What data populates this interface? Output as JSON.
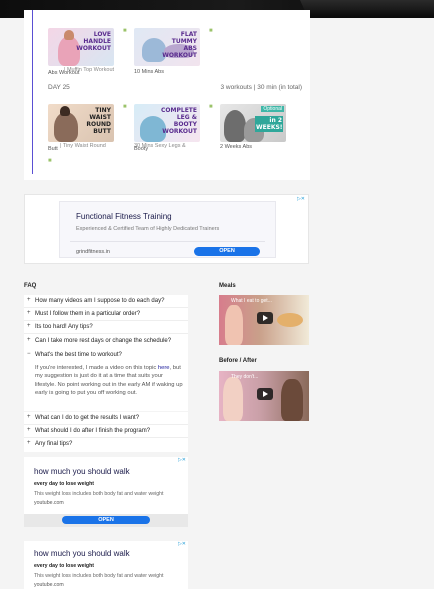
{
  "schedule": {
    "week_row_1": [
      {
        "title": "LOVE HANDLE WORKOUT",
        "caption": "Abs Workout",
        "caption_overlap": "| Muffin Top Workout"
      },
      {
        "title": "FLAT TUMMY ABS WORKOUT",
        "caption": "10 Mins Abs"
      }
    ],
    "day_label": "DAY 25",
    "day_summary": "3 workouts | 30 min (in total)",
    "week_row_2": [
      {
        "title": "TINY WAIST ROUND BUTT",
        "caption": "Butt",
        "caption_overlap": "| Tiny Waist Round"
      },
      {
        "title": "COMPLETE LEG & BOOTY WORKOUT",
        "caption": "Booty",
        "caption_overlap": "30 Mins Sexy Legs &"
      },
      {
        "title": "in 2 WEEKS!",
        "badge": "Optional",
        "caption": "2 Weeks Abs"
      }
    ]
  },
  "ad_top": {
    "title": "Functional Fitness Training",
    "subtitle": "Experienced & Certified Team of Highly Dedicated Trainers",
    "domain": "grindfitness.in",
    "button": "OPEN"
  },
  "faq": {
    "heading": "FAQ",
    "group1": [
      "How many videos am I suppose to do each day?",
      "Must I follow them in a particular order?",
      "Its too hard! Any tips?",
      "Can I take more rest days or change the schedule?",
      "What's the best time to workout?"
    ],
    "answer": {
      "pre": "If you're interested, I made a video on this topic ",
      "link": "here",
      "post": ", but my suggestion is just do it at a time that suits your lifestyle. No point working out in the early AM if waking up early is going to put you off working out."
    },
    "group2": [
      "What can I do to get the results I want?",
      "What should I do after I finish the program?",
      "Any final tips?"
    ]
  },
  "sidebar": {
    "meals_heading": "Meals",
    "meals_video_title": "What I eat to get...",
    "before_after_heading": "Before / After",
    "before_after_video_title": "They don't..."
  },
  "ad_bottom_1": {
    "title": "how much you should walk",
    "line1": "every day to lose weight",
    "line2": "This weight loss includes both body fat and water weight",
    "domain": "youtube.com",
    "button": "OPEN"
  },
  "ad_bottom_2": {
    "title": "how much you should walk",
    "line1": "every day to lose weight",
    "line2": "This weight loss includes both body fat and water weight",
    "domain": "youtube.com"
  },
  "colors": {
    "accent": "#5a4fd3",
    "ad_button": "#1a73e8",
    "bullet": "#9bc36a"
  }
}
